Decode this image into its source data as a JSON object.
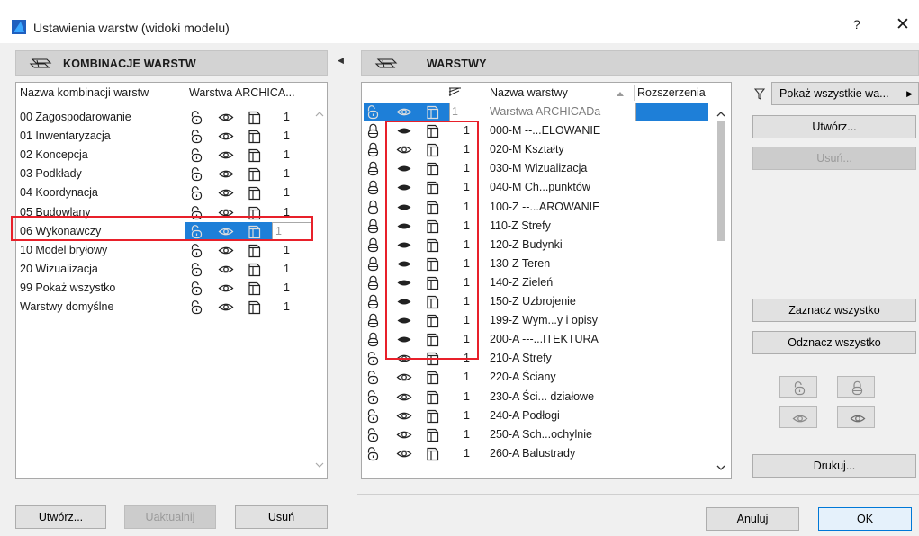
{
  "window": {
    "title": "Ustawienia warstw (widoki modelu)",
    "help": "?",
    "close": "✕"
  },
  "left": {
    "header": "KOMBINACJE WARSTW",
    "col_name": "Nazwa kombinacji warstw",
    "col_layer": "Warstwa ARCHICA...",
    "rows": [
      {
        "name": "00 Zagospodarowanie",
        "num": "1"
      },
      {
        "name": "01 Inwentaryzacja",
        "num": "1"
      },
      {
        "name": "02 Koncepcja",
        "num": "1"
      },
      {
        "name": "03 Podkłady",
        "num": "1"
      },
      {
        "name": "04 Koordynacja",
        "num": "1"
      },
      {
        "name": "05 Budowlany",
        "num": "1"
      },
      {
        "name": "06 Wykonawczy",
        "num": "1"
      },
      {
        "name": "10 Model bryłowy",
        "num": "1"
      },
      {
        "name": "20 Wizualizacja",
        "num": "1"
      },
      {
        "name": "99 Pokaż wszystko",
        "num": "1"
      },
      {
        "name": "Warstwy domyślne",
        "num": "1"
      }
    ],
    "selected_index": 6,
    "buttons": {
      "create": "Utwórz...",
      "update": "Uaktualnij",
      "delete": "Usuń"
    }
  },
  "right": {
    "header": "WARSTWY",
    "col_name": "Nazwa warstwy",
    "col_ext": "Rozszerzenia",
    "rows": [
      {
        "name": "Warstwa ARCHICADa",
        "num": "1",
        "locked": false,
        "hidden": false
      },
      {
        "name": "000-M --...ELOWANIE",
        "num": "1",
        "locked": true,
        "hidden": true
      },
      {
        "name": "020-M Kształty",
        "num": "1",
        "locked": true,
        "hidden": false
      },
      {
        "name": "030-M Wizualizacja",
        "num": "1",
        "locked": true,
        "hidden": true
      },
      {
        "name": "040-M Ch...punktów",
        "num": "1",
        "locked": true,
        "hidden": true
      },
      {
        "name": "100-Z --...AROWANIE",
        "num": "1",
        "locked": true,
        "hidden": true
      },
      {
        "name": "110-Z Strefy",
        "num": "1",
        "locked": true,
        "hidden": true
      },
      {
        "name": "120-Z Budynki",
        "num": "1",
        "locked": true,
        "hidden": true
      },
      {
        "name": "130-Z Teren",
        "num": "1",
        "locked": true,
        "hidden": true
      },
      {
        "name": "140-Z Zieleń",
        "num": "1",
        "locked": true,
        "hidden": true
      },
      {
        "name": "150-Z Uzbrojenie",
        "num": "1",
        "locked": true,
        "hidden": true
      },
      {
        "name": "199-Z Wym...y i opisy",
        "num": "1",
        "locked": true,
        "hidden": true
      },
      {
        "name": "200-A ---...ITEKTURA",
        "num": "1",
        "locked": true,
        "hidden": true
      },
      {
        "name": "210-A Strefy",
        "num": "1",
        "locked": false,
        "hidden": false
      },
      {
        "name": "220-A Ściany",
        "num": "1",
        "locked": false,
        "hidden": false
      },
      {
        "name": "230-A Ści... działowe",
        "num": "1",
        "locked": false,
        "hidden": false
      },
      {
        "name": "240-A Podłogi",
        "num": "1",
        "locked": false,
        "hidden": false
      },
      {
        "name": "250-A Sch...ochylnie",
        "num": "1",
        "locked": false,
        "hidden": false
      },
      {
        "name": "260-A Balustrady",
        "num": "1",
        "locked": false,
        "hidden": false
      }
    ],
    "filter": "Pokaż wszystkie wa...",
    "buttons": {
      "create": "Utwórz...",
      "delete": "Usuń...",
      "select_all": "Zaznacz wszystko",
      "deselect_all": "Odznacz wszystko",
      "print": "Drukuj..."
    }
  },
  "footer": {
    "cancel": "Anuluj",
    "ok": "OK"
  },
  "colors": {
    "accent": "#0078d7",
    "selection": "#1e7fd8",
    "highlight": "#e8202a"
  }
}
